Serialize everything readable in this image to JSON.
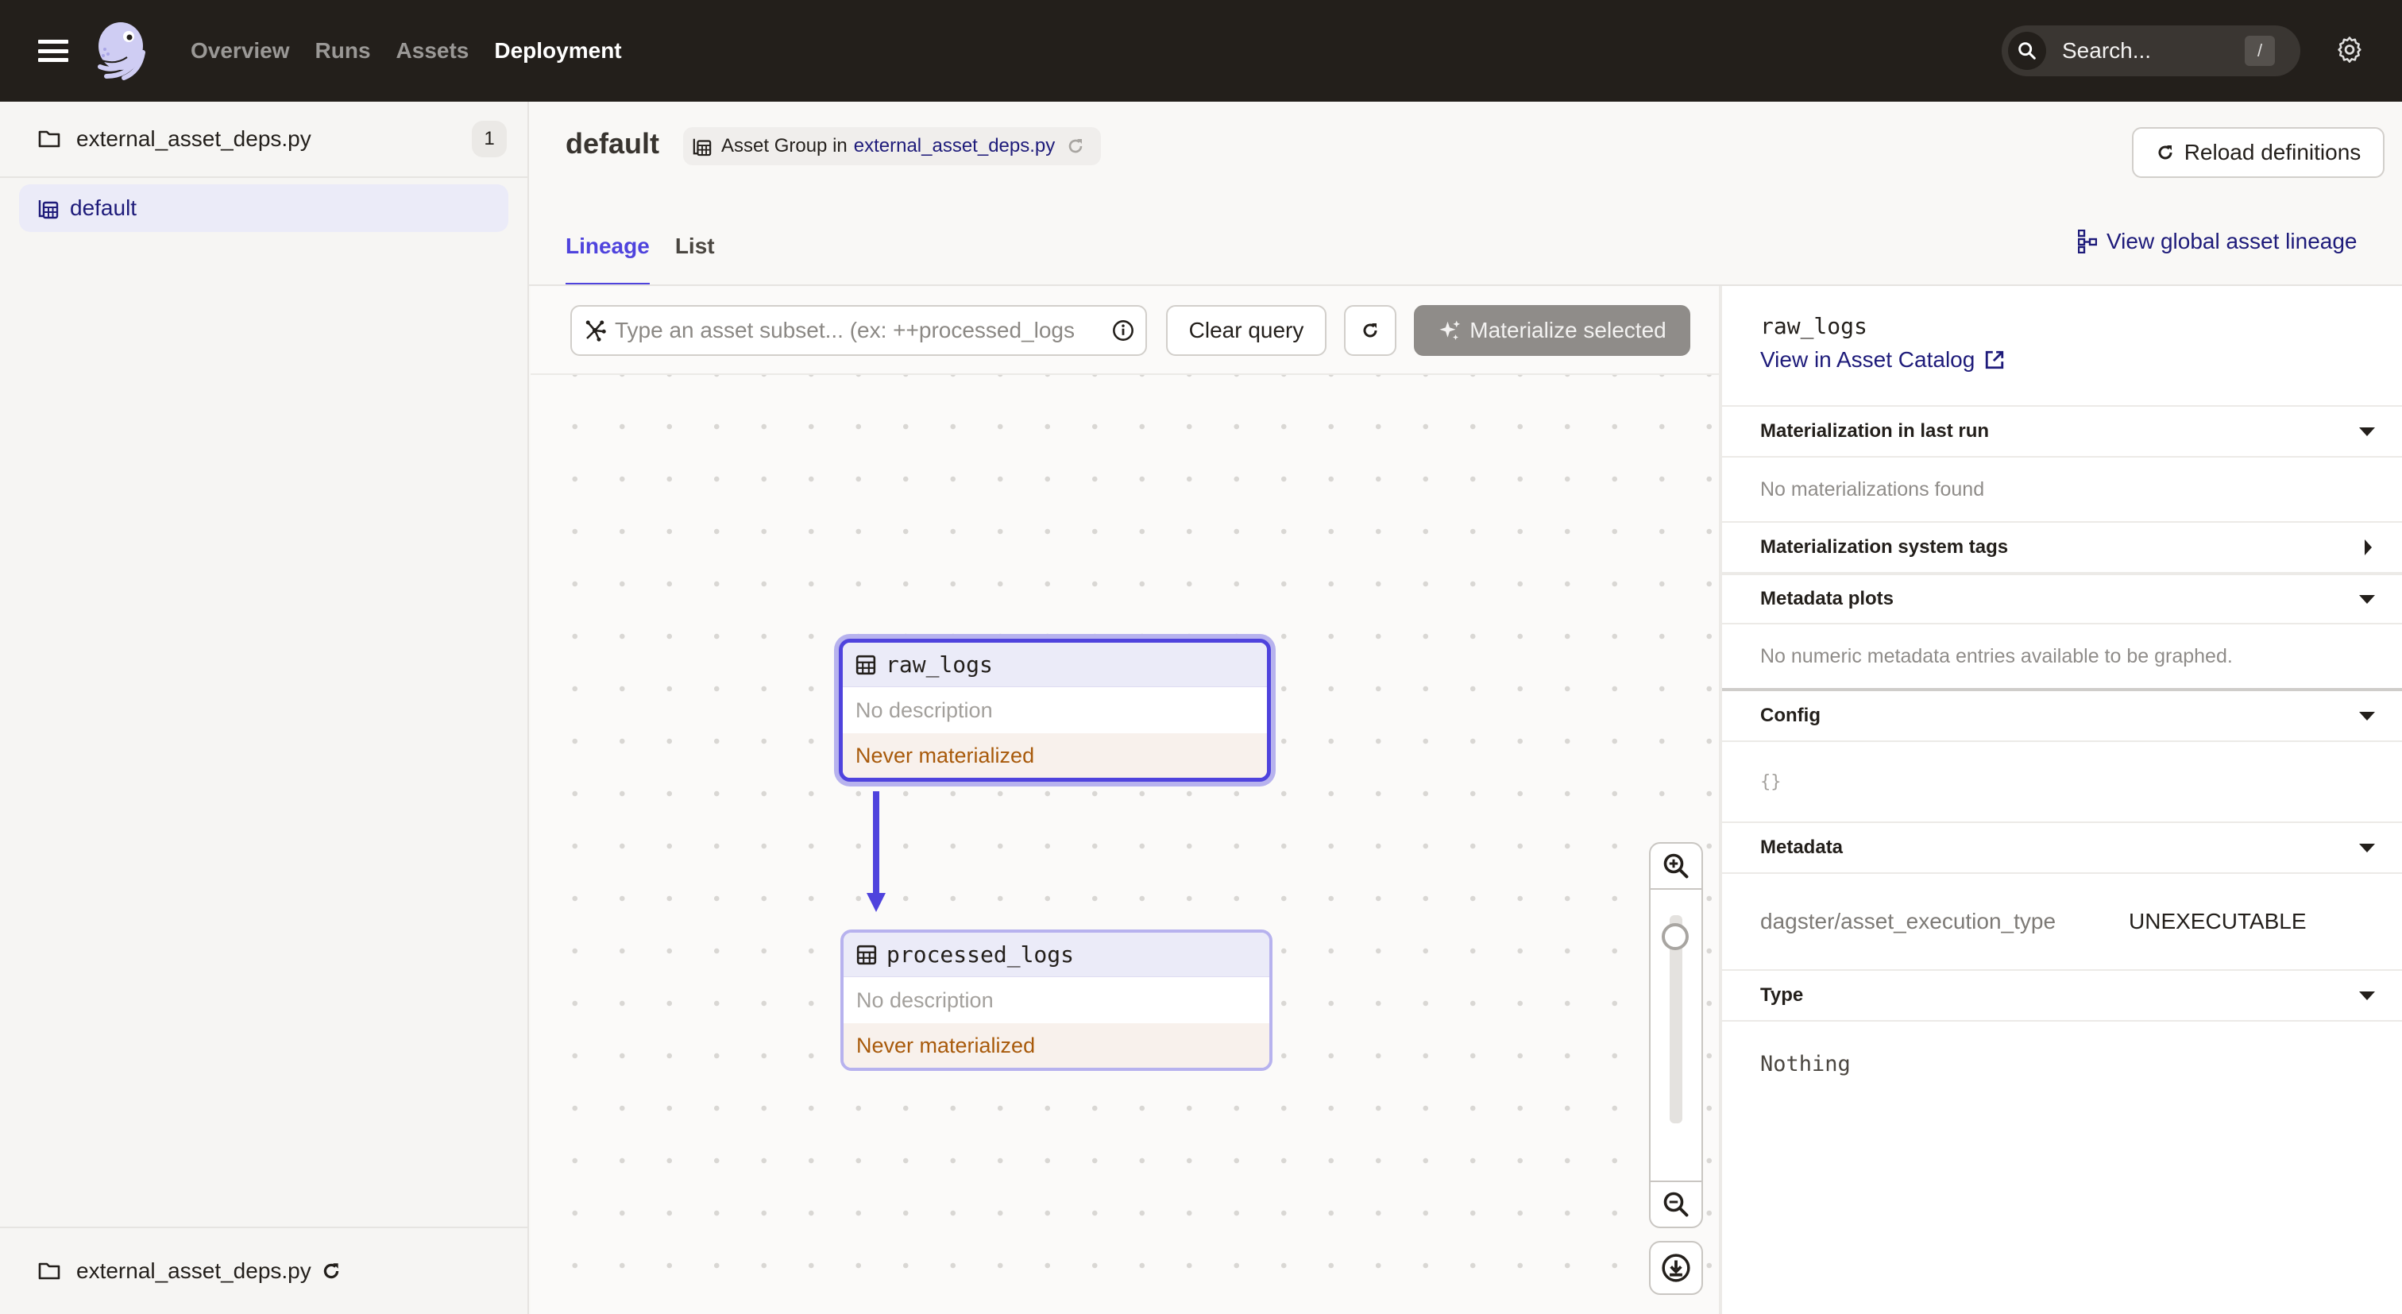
{
  "topbar": {
    "nav": [
      {
        "label": "Overview",
        "active": false
      },
      {
        "label": "Runs",
        "active": false
      },
      {
        "label": "Assets",
        "active": false
      },
      {
        "label": "Deployment",
        "active": true
      }
    ],
    "search_placeholder": "Search...",
    "search_shortcut": "/"
  },
  "sidebar": {
    "repo_name": "external_asset_deps.py",
    "repo_count": "1",
    "groups": [
      {
        "label": "default",
        "selected": true
      }
    ],
    "footer_repo": "external_asset_deps.py"
  },
  "page": {
    "title": "default",
    "tag_prefix": "Asset Group in",
    "tag_link": "external_asset_deps.py",
    "reload_label": "Reload definitions",
    "tabs": [
      {
        "label": "Lineage",
        "active": true
      },
      {
        "label": "List",
        "active": false
      }
    ],
    "global_lineage_label": "View global asset lineage"
  },
  "toolbar": {
    "query_placeholder": "Type an asset subset... (ex: ++processed_logs",
    "clear_label": "Clear query",
    "materialize_label": "Materialize selected"
  },
  "graph": {
    "nodes": [
      {
        "name": "raw_logs",
        "description": "No description",
        "status": "Never materialized",
        "selected": true
      },
      {
        "name": "processed_logs",
        "description": "No description",
        "status": "Never materialized",
        "selected": false
      }
    ],
    "edges": [
      {
        "from": "raw_logs",
        "to": "processed_logs"
      }
    ],
    "zoom_level": 0.12
  },
  "panel": {
    "asset_name": "raw_logs",
    "catalog_link": "View in Asset Catalog",
    "sections": {
      "mat_last_run": {
        "title": "Materialization in last run",
        "body": "No materializations found",
        "expanded": true
      },
      "mat_tags": {
        "title": "Materialization system tags",
        "expanded": false
      },
      "meta_plots": {
        "title": "Metadata plots",
        "body": "No numeric metadata entries available to be graphed.",
        "expanded": true
      },
      "config": {
        "title": "Config",
        "body": "{}",
        "expanded": true
      },
      "metadata": {
        "title": "Metadata",
        "key": "dagster/asset_execution_type",
        "value": "UNEXECUTABLE",
        "expanded": true
      },
      "type": {
        "title": "Type",
        "body": "Nothing",
        "expanded": true
      }
    }
  },
  "colors": {
    "accent": "#4f43dd",
    "link": "#1e1b7a",
    "topbar": "#231f1b",
    "warning_text": "#a85a0b"
  }
}
